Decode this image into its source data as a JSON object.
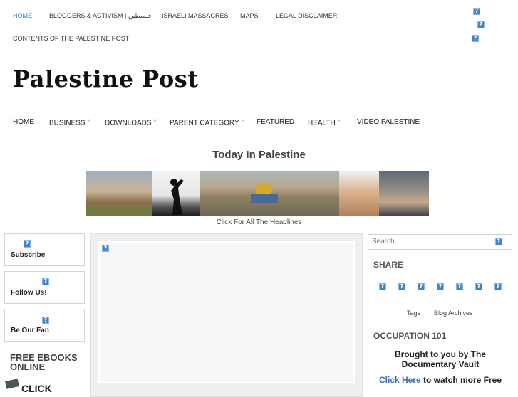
{
  "top_nav": {
    "items": [
      "HOME",
      "BLOGGERS & ACTIVISM | فلسطين",
      "ISRAELI MASSACRES",
      "MAPS",
      "LEGAL DISCLAIMER"
    ],
    "second_row": "CONTENTS OF THE PALESTINE POST"
  },
  "logo": {
    "text": "Palestine Post"
  },
  "main_nav": {
    "items": [
      "HOME",
      "BUSINESS",
      "DOWNLOADS",
      "PARENT CATEGORY",
      "FEATURED",
      "HEALTH",
      "VIDEO PALESTINE"
    ],
    "submenu_marker": "»"
  },
  "headline": {
    "title": "Today In Palestine",
    "caption": "Click For All The Headlines"
  },
  "left_sidebar": {
    "subscribe": "Subscribe",
    "follow": "Follow Us!",
    "fan": "Be Our Fan",
    "ebooks_line1": "FREE EBOOKS",
    "ebooks_line2": "ONLINE",
    "ebook_click": "CLICK"
  },
  "right_sidebar": {
    "search_placeholder": "Search",
    "share_title": "SHARE",
    "tags": "Tags",
    "archives": "Blog Archives",
    "occupation_title": "OCCUPATION 101",
    "brought_line1": "Brought to you by The",
    "brought_line2": "Documentary Vault",
    "click_here": "Click Here",
    "click_rest": " to watch more Free"
  },
  "icon_glyph": "?",
  "colors": {
    "accent": "#3a78c9",
    "icon_blue": "#3e86c9"
  }
}
